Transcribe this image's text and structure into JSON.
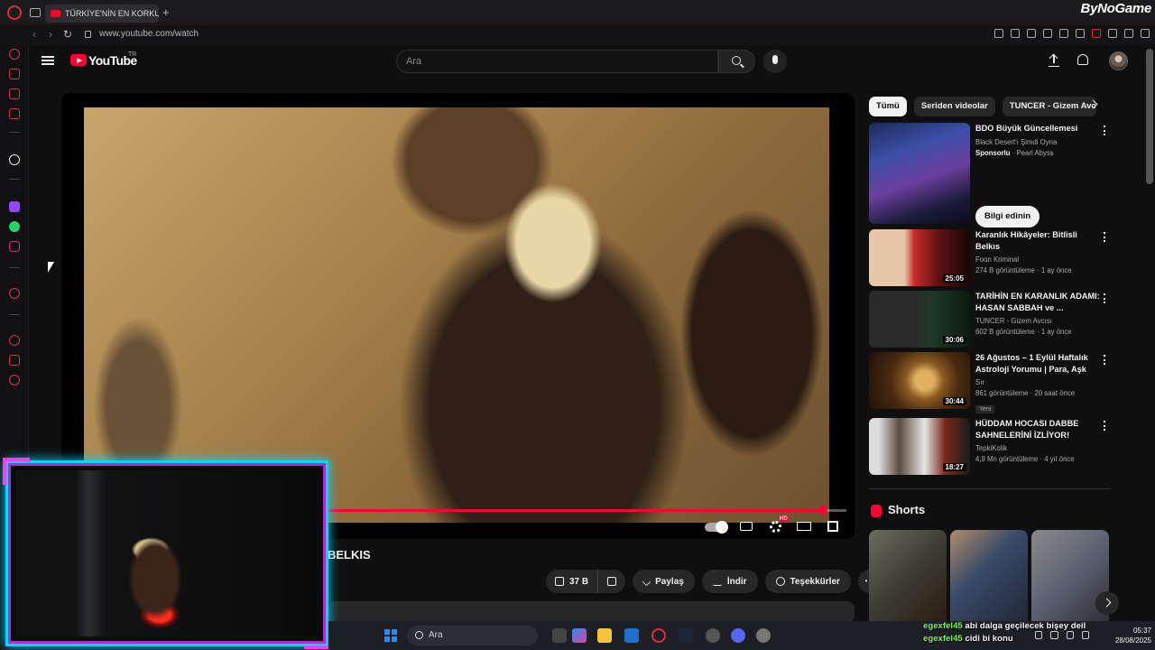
{
  "browser": {
    "tab_title": "TÜRKİYE'NİN EN KORKUN",
    "url": "www.youtube.com/watch",
    "brand": "ByNoGame",
    "accent": "#e0283f"
  },
  "youtube": {
    "logo_text": "YouTube",
    "region": "TR",
    "search_placeholder": "Ara",
    "accent": "#ff0033"
  },
  "player": {
    "progress_fraction": 0.955
  },
  "video": {
    "title_visible": "BELKIS",
    "likes": "37 B",
    "share_label": "Paylaş",
    "download_label": "İndir",
    "thanks_label": "Teşekkürler",
    "more_label": "⋯"
  },
  "chips": [
    "Tümü",
    "Seriden videolar",
    "TUNCER - Gizem Avcı"
  ],
  "recommendations": [
    {
      "title": "BDO Büyük Güncellemesi",
      "line1": "Black Desert'ı Şimdi Oyna",
      "sponsor": "Sponsorlu",
      "line2": "· Pearl Abyss",
      "cta": "Bilgi edinin"
    },
    {
      "title": "Karanlık Hikâyeler: Bitlisli Belkıs",
      "channel": "Foon Kriminal",
      "stats": "274 B görüntüleme · 1 ay önce",
      "duration": "25:05"
    },
    {
      "title": "TARİHİN EN KARANLIK ADAMI: HASAN SABBAH ve ...",
      "channel": "TUNCER - Gizem Avcısı",
      "stats": "602 B görüntüleme · 1 ay önce",
      "duration": "30:06"
    },
    {
      "title": "26 Ağustos – 1 Eylül Haftalık Astroloji Yorumu | Para, Aşk ve...",
      "channel": "Sır",
      "stats": "861 görüntüleme · 20 saat önce",
      "badge": "Yeni",
      "duration": "30:44"
    },
    {
      "title": "HÜDDAM HOCASI DABBE SAHNELERİNİ İZLİYOR!",
      "channel": "TepkiKolik",
      "stats": "4,9 Mn görüntüleme · 4 yıl önce",
      "duration": "18:27"
    }
  ],
  "shorts": {
    "title": "Shorts"
  },
  "taskbar": {
    "search": "Ara",
    "time": "05:37",
    "date": "28/08/2025"
  },
  "chat": [
    {
      "user": "egexfel45",
      "message": "abi dalga geçilecek bişey deil"
    },
    {
      "user": "egexfel45",
      "message": "cidi bi konu"
    }
  ]
}
